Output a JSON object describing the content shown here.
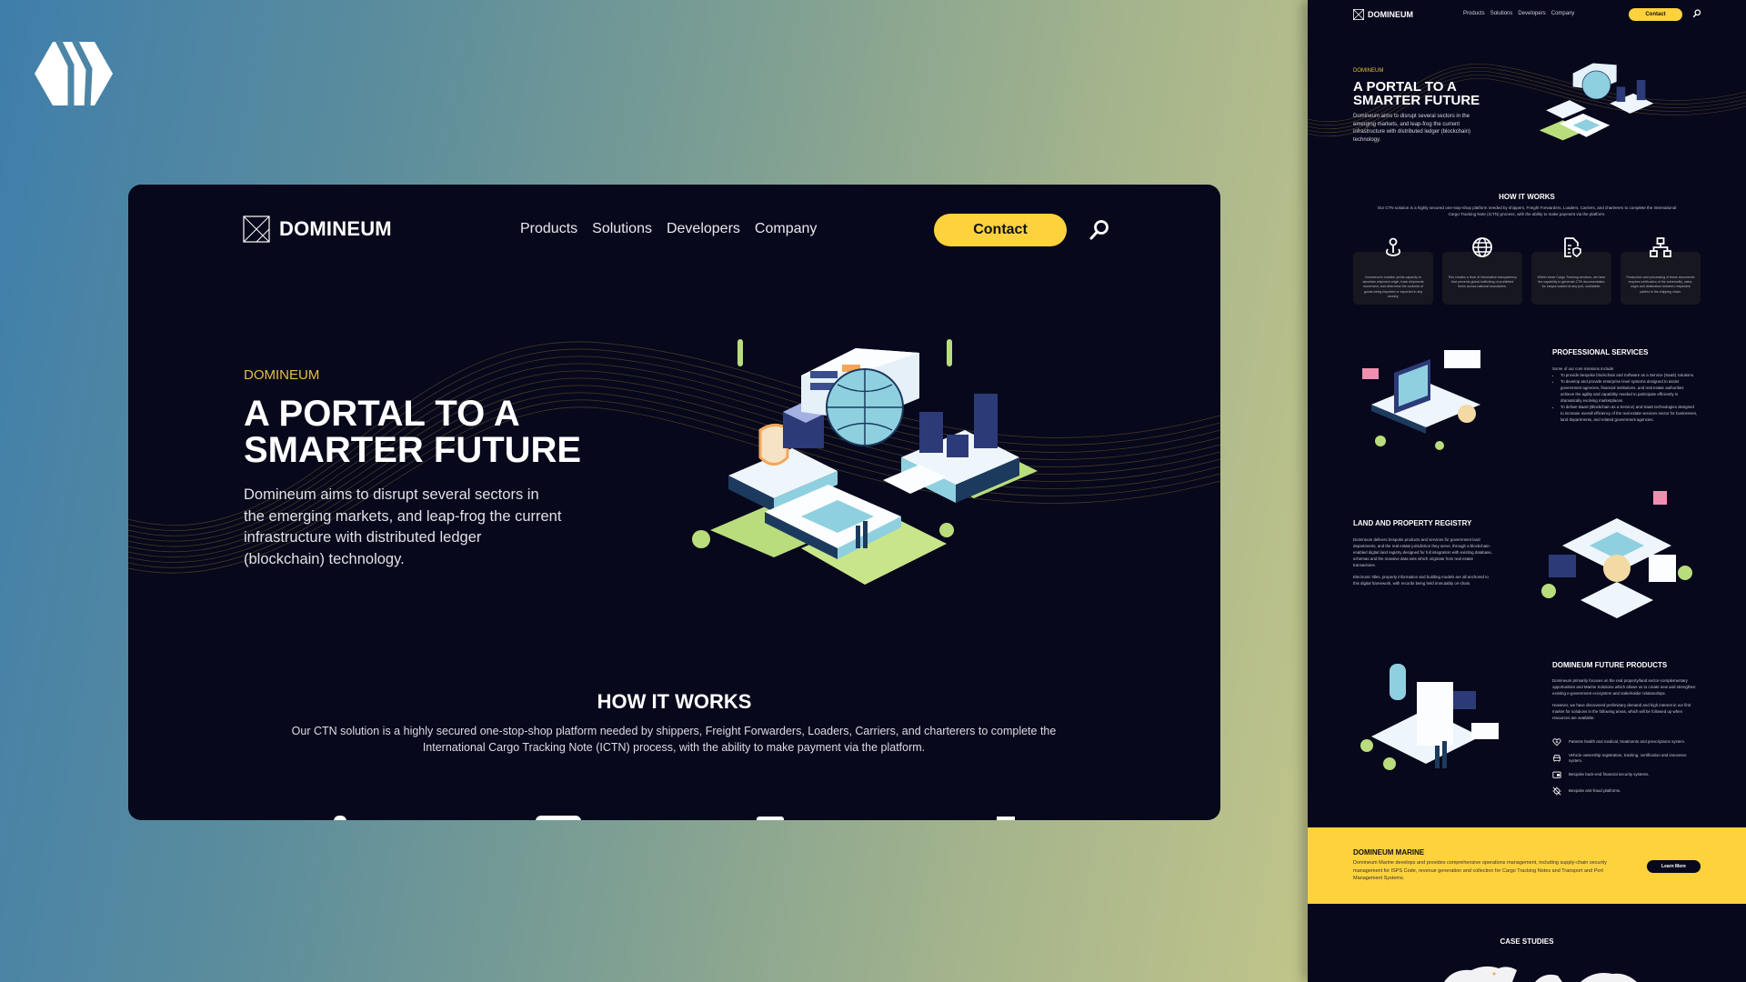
{
  "brand_mark": "hexagon-monogram-logo",
  "site": {
    "logo_text": "DOMINEUM",
    "nav": [
      "Products",
      "Solutions",
      "Developers",
      "Company"
    ],
    "contact_label": "Contact",
    "search_icon": "search-icon"
  },
  "hero": {
    "eyebrow": "DOMINEUM",
    "title_line1": "A PORTAL TO A",
    "title_line2": "SMARTER FUTURE",
    "description": "Domineum aims to disrupt several sectors in the emerging markets, and leap-frog the current infrastructure with distributed ledger (blockchain) technology."
  },
  "how_it_works": {
    "title": "HOW IT WORKS",
    "description": "Our CTN solution is a highly secured one-stop-shop platform needed by shippers, Freight Forwarders, Loaders, Carriers, and charterers to complete the International Cargo Tracking Note (ICTN) process, with the ability to make payment via the platform.",
    "cards": [
      {
        "icon": "location-pin-icon",
        "text": "Domineum's solution yields capacity to ascertain shipment origin, track shipments movement, and determine the contents of goods being imported or exported in any country."
      },
      {
        "icon": "globe-icon",
        "text": "This creates a level of information transparency that prevents global trafficking of prohibited items across national boundaries."
      },
      {
        "icon": "document-shield-icon",
        "text": "Within these Cargo Tracking services, we have the capability to generate CTN documentation for cargos loaded at any port, worldwide."
      },
      {
        "icon": "hierarchy-icon",
        "text": "Production and processing of these documents requires verification of the commodity, value, origin and destination between respective parties in the shipping chain."
      }
    ]
  },
  "professional_services": {
    "title": "PROFESSIONAL SERVICES",
    "intro": "Some of our core missions include:",
    "items": [
      "To provide bespoke blockchain and Software as a Service (SaaS) solutions.",
      "To develop and provide enterprise level systems designed to assist government agencies, financial institutions, and real estate authorities achieve the agility and capability needed to participate efficiently in dramatically evolving marketplaces.",
      "To deliver BaaS (Blockchain as a Service) and SaaS technologies designed to increase overall efficiency of the real estate services sector for businesses, land departments, and related government agencies."
    ]
  },
  "land_registry": {
    "title": "LAND AND PROPERTY REGISTRY",
    "paragraph1": "Domineum delivers bespoke products and services for government land departments, and the real estate jurisdiction they serve, through a blockchain-enabled digital land registry designed for full integration with existing database, schemas and the massive data sets which originate from real estate transactions.",
    "paragraph2": "Electronic titles, property information and building models are all anchored to this digital framework, with records being held immutably on-chain."
  },
  "future_products": {
    "title": "DOMINEUM FUTURE PRODUCTS",
    "paragraph1": "Domineum primarily focuses on the real property/land sector-complementary opportunities and Marine Solutions which allows us to create new and strengthen existing e-government ecosystem and stakeholder relationships.",
    "paragraph2": "However, we have discovered preliminary demand and high interest in our first market for solutions in the following areas, which will be followed up when resources are available:",
    "items": [
      {
        "icon": "heart-plus-icon",
        "text": "Patients health and medical, treatments and prescriptions system."
      },
      {
        "icon": "car-icon",
        "text": "Vehicle ownership registration, tracking, certification and insurance system."
      },
      {
        "icon": "wallet-icon",
        "text": "Bespoke back-end financial security systems."
      },
      {
        "icon": "anti-fraud-icon",
        "text": "Bespoke anti-fraud platforms."
      }
    ]
  },
  "marine": {
    "title": "DOMINEUM MARINE",
    "text": "Domineum Marine develops and provides comprehensive operations management, including supply-chain security management for ISPS Code, revenue generation and collection for Cargo Tracking Notes and Transport and Port Management Systems.",
    "button_label": "Learn More"
  },
  "case_studies": {
    "title": "CASE STUDIES"
  },
  "colors": {
    "accent_yellow": "#fdd23d",
    "page_dark": "#07081b",
    "eyebrow_gold": "#e4c03d"
  }
}
